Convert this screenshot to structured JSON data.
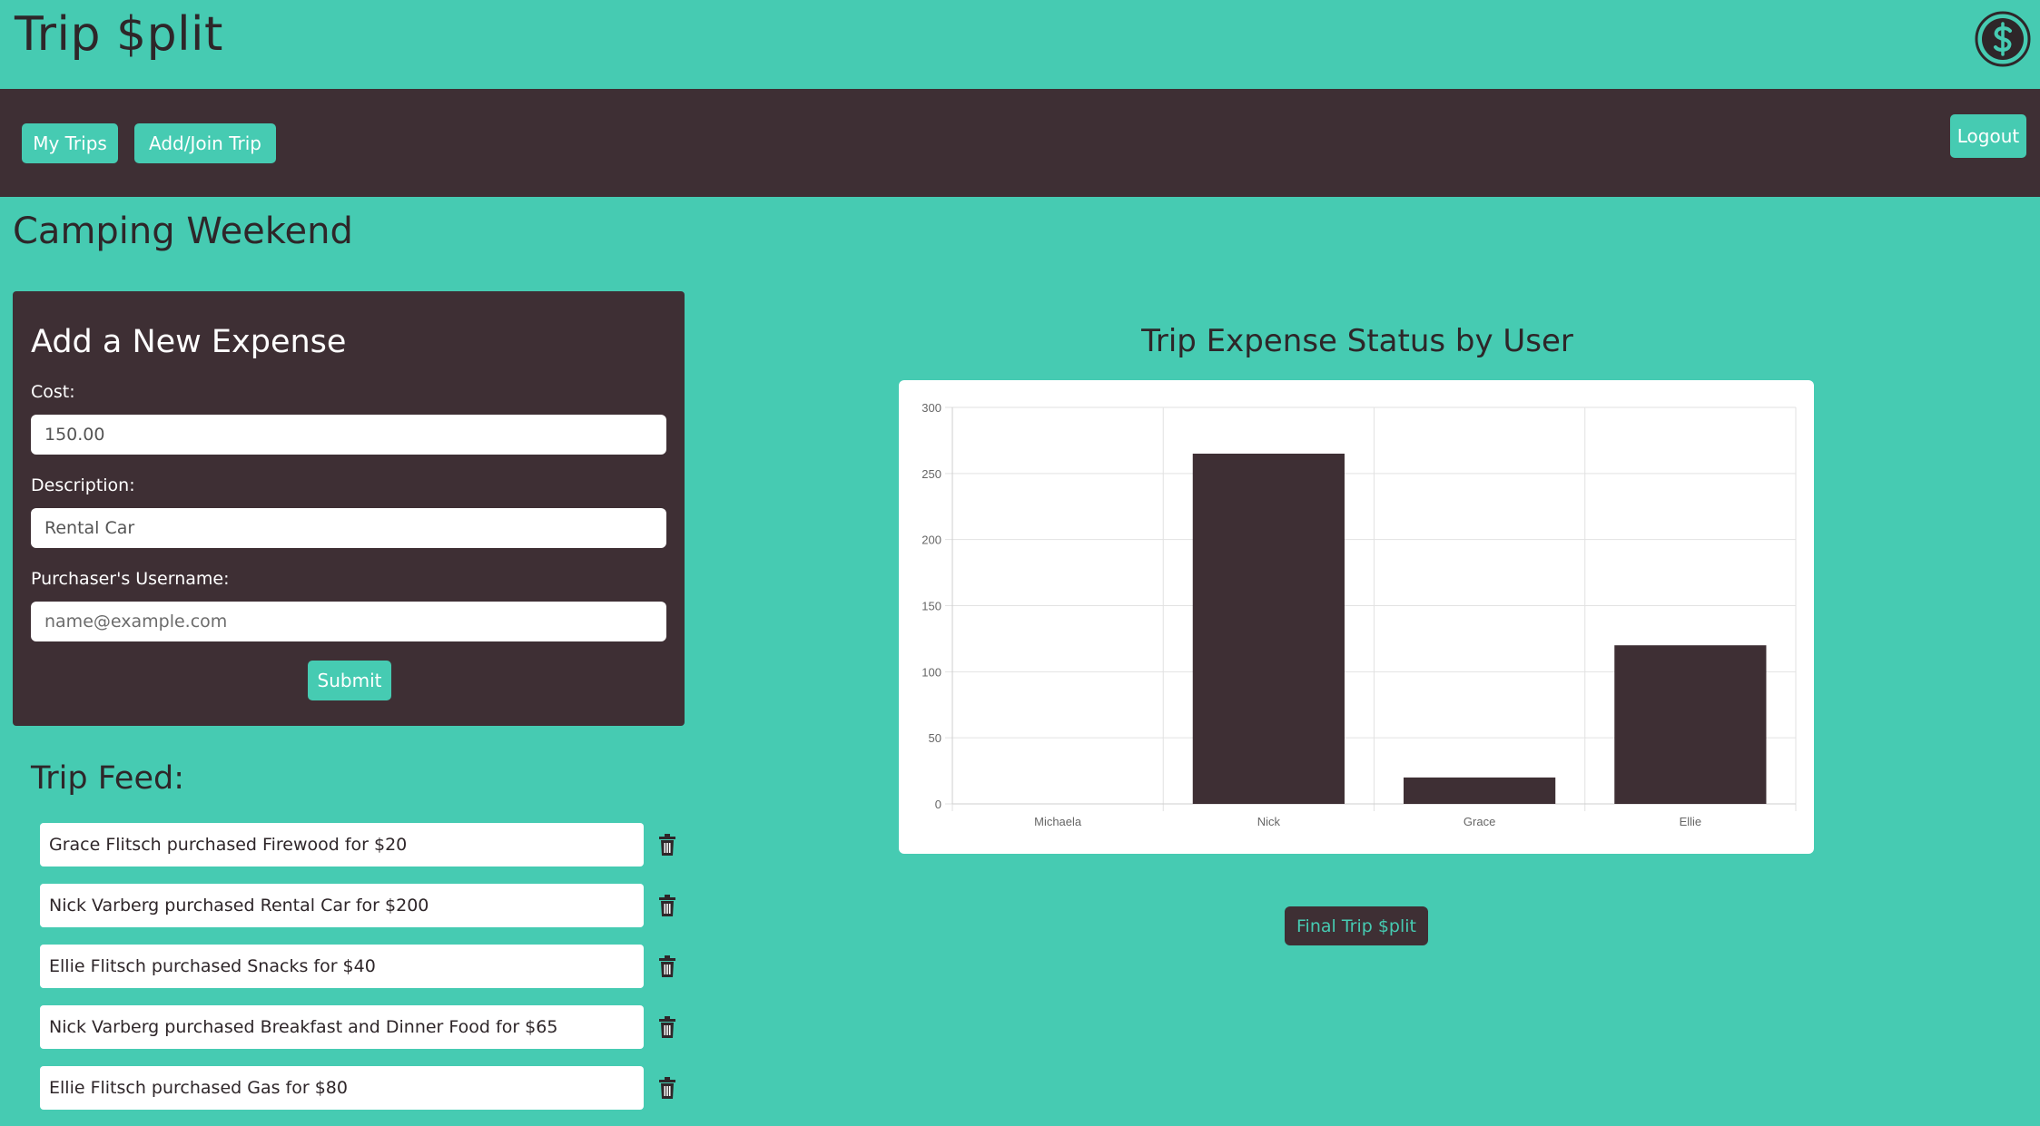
{
  "app": {
    "brand": "Trip $plit",
    "logo_icon": "dollar-coin-icon"
  },
  "nav": {
    "my_trips": "My Trips",
    "add_join_trip": "Add/Join Trip",
    "logout": "Logout"
  },
  "trip": {
    "title": "Camping Weekend"
  },
  "expense_form": {
    "title": "Add a New Expense",
    "cost_label": "Cost:",
    "cost_value": "150.00",
    "description_label": "Description:",
    "description_value": "Rental Car",
    "purchaser_label": "Purchaser's Username:",
    "purchaser_placeholder": "name@example.com",
    "submit_label": "Submit"
  },
  "feed": {
    "title": "Trip Feed:",
    "items": [
      "Grace Flitsch purchased Firewood for $20",
      "Nick Varberg purchased Rental Car for $200",
      "Ellie Flitsch purchased Snacks for $40",
      "Nick Varberg purchased Breakfast and Dinner Food for $65",
      "Ellie Flitsch purchased Gas for $80"
    ],
    "delete_icon": "trash-icon"
  },
  "chart_heading": "Trip Expense Status by User",
  "final_button": "Final Trip $plit",
  "colors": {
    "background": "#46cbb2",
    "dark": "#3e2f34",
    "bar": "#3e2f34"
  },
  "chart_data": {
    "type": "bar",
    "title": "Trip Expense Status by User",
    "categories": [
      "Michaela",
      "Nick",
      "Grace",
      "Ellie"
    ],
    "values": [
      0,
      265,
      20,
      120
    ],
    "ylim": [
      0,
      300
    ],
    "yticks": [
      0,
      50,
      100,
      150,
      200,
      250,
      300
    ],
    "grid": true,
    "legend": "none"
  }
}
